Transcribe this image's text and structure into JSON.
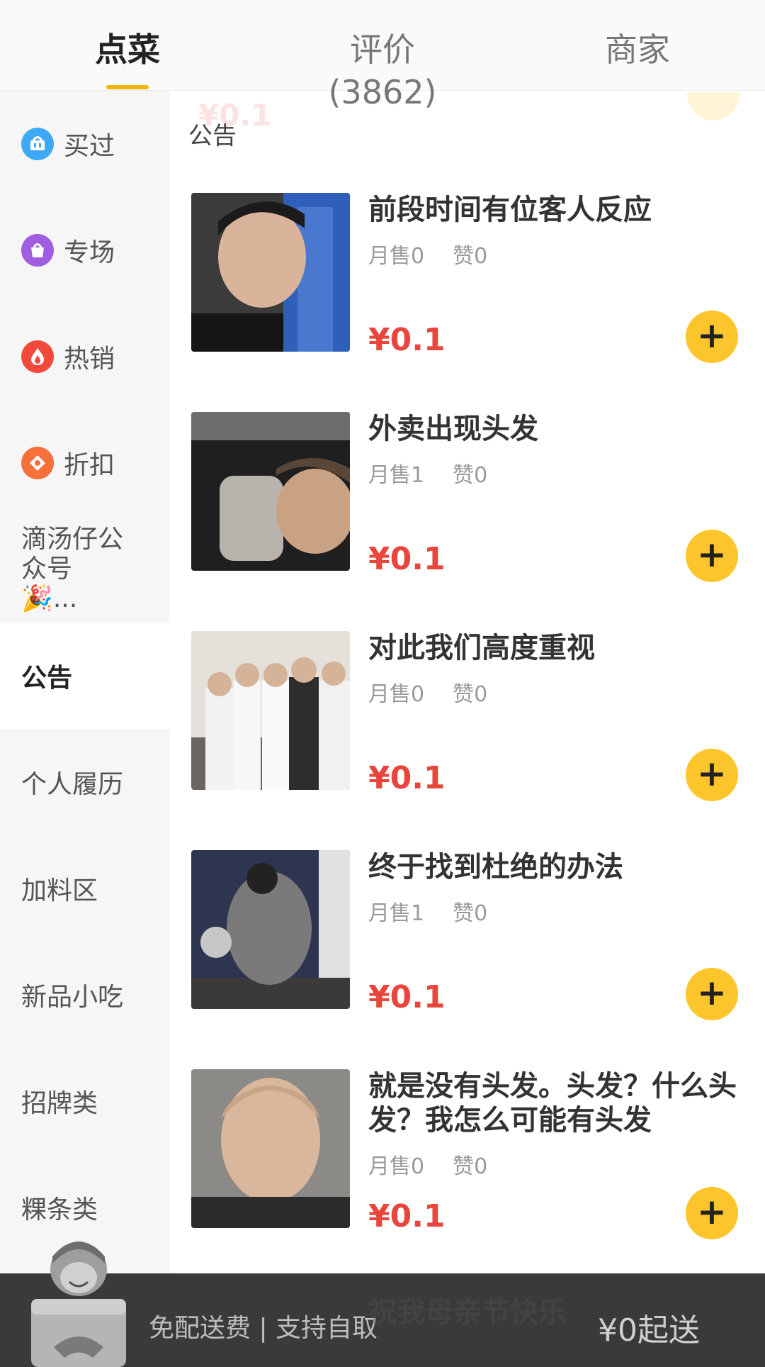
{
  "tabs": [
    {
      "label": "点菜",
      "active": true
    },
    {
      "label": "评价(3862)",
      "active": false
    },
    {
      "label": "商家",
      "active": false
    }
  ],
  "sidebar": {
    "items": [
      {
        "label": "买过",
        "icon": "basket-icon",
        "color": "#3fa9f5"
      },
      {
        "label": "专场",
        "icon": "bag-icon",
        "color": "#a05de0"
      },
      {
        "label": "热销",
        "icon": "fire-icon",
        "color": "#f24a3a"
      },
      {
        "label": "折扣",
        "icon": "discount-tag-icon",
        "color": "#f5703a"
      },
      {
        "label": "滴汤仔公众号🎉..."
      },
      {
        "label": "公告",
        "active": true
      },
      {
        "label": "个人履历"
      },
      {
        "label": "加料区"
      },
      {
        "label": "新品小吃"
      },
      {
        "label": "招牌类"
      },
      {
        "label": "粿条类"
      }
    ]
  },
  "content": {
    "section_title": "公告",
    "ghost_price": "¥0.1",
    "items": [
      {
        "title": "前段时间有位客人反应",
        "monthly_sales": "月售0",
        "likes": "赞0",
        "price": "¥0.1"
      },
      {
        "title": "外卖出现头发",
        "monthly_sales": "月售1",
        "likes": "赞0",
        "price": "¥0.1"
      },
      {
        "title": "对此我们高度重视",
        "monthly_sales": "月售0",
        "likes": "赞0",
        "price": "¥0.1"
      },
      {
        "title": "终于找到杜绝的办法",
        "monthly_sales": "月售1",
        "likes": "赞0",
        "price": "¥0.1"
      },
      {
        "title": "就是没有头发。头发？什么头发？我怎么可能有头发",
        "monthly_sales": "月售0",
        "likes": "赞0",
        "price": "¥0.1"
      }
    ],
    "next_item_title": "祝我母亲节快乐"
  },
  "bottom_bar": {
    "delivery": "免配送费 | 支持自取",
    "min_order": "¥0起送"
  },
  "colors": {
    "accent": "#f5b400",
    "price": "#e8453c",
    "add_button": "#fdc52c"
  }
}
